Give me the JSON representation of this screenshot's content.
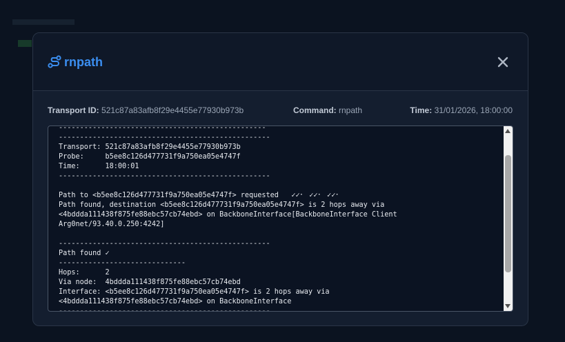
{
  "dialog": {
    "title": "rnpath",
    "title_icon": "route-icon",
    "close_icon": "close-icon",
    "accent_color": "#3b8ef0"
  },
  "meta": {
    "transport_label": "Transport ID:",
    "transport_value": "521c87a83afb8f29e4455e77930b973b",
    "command_label": "Command:",
    "command_value": "rnpath",
    "time_label": "Time:",
    "time_value": "31/01/2026, 18:00:00"
  },
  "terminal": {
    "output": "-------------------------------------------------\n--------------------------------------------------\nTransport: 521c87a83afb8f29e4455e77930b973b\nProbe:     b5ee8c126d477731f9a750ea05e4747f\nTime:      18:00:01\n--------------------------------------------------\n\nPath to <b5ee8c126d477731f9a750ea05e4747f> requested   ✓✓⠂ ✓✓⠂ ✓✓⠂\nPath found, destination <b5ee8c126d477731f9a750ea05e4747f> is 2 hops away via\n<4bddda111438f875fe88ebc57cb74ebd> on BackboneInterface[BackboneInterface Client\nArg0net/93.40.0.250:4242]\n\n--------------------------------------------------\nPath found ✓\n------------------------------\nHops:      2\nVia node:  4bddda111438f875fe88ebc57cb74ebd\nInterface: <b5ee8c126d477731f9a750ea05e4747f> is 2 hops away via\n<4bddda111438f875fe88ebc57cb74ebd> on BackboneInterface\n--------------------------------------------------"
  }
}
